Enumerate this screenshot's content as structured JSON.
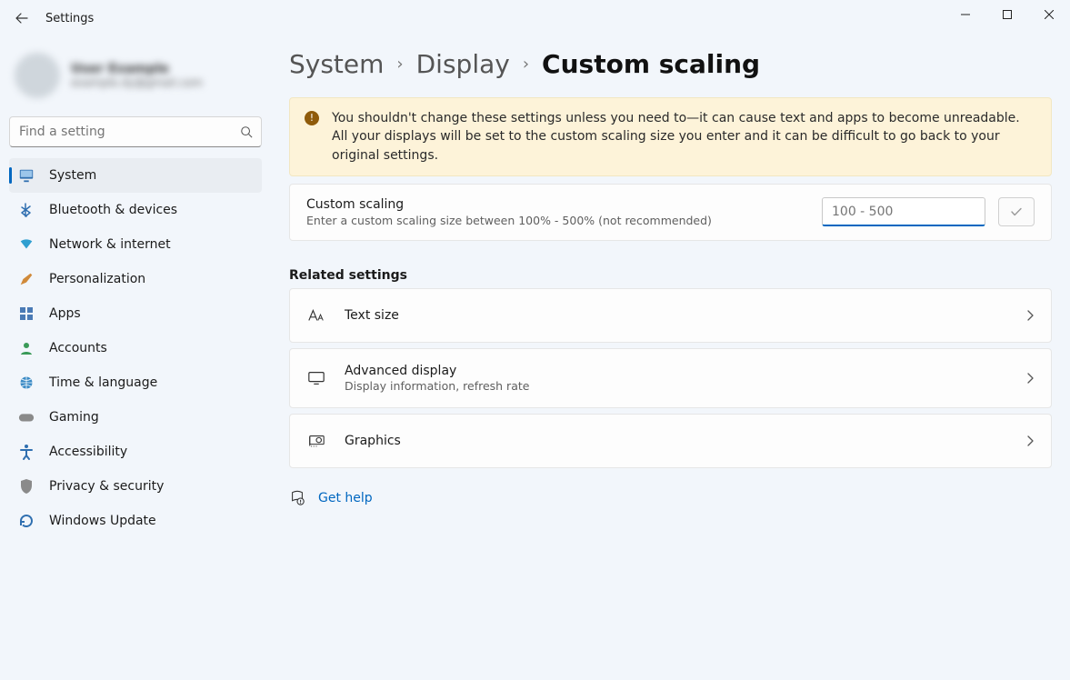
{
  "app_title": "Settings",
  "profile": {
    "name": "User Example",
    "email": "example.dy@gmail.com"
  },
  "search": {
    "placeholder": "Find a setting"
  },
  "sidebar": {
    "items": [
      {
        "label": "System",
        "icon": "monitor",
        "selected": true
      },
      {
        "label": "Bluetooth & devices",
        "icon": "bluetooth",
        "selected": false
      },
      {
        "label": "Network & internet",
        "icon": "wifi",
        "selected": false
      },
      {
        "label": "Personalization",
        "icon": "brush",
        "selected": false
      },
      {
        "label": "Apps",
        "icon": "grid",
        "selected": false
      },
      {
        "label": "Accounts",
        "icon": "person",
        "selected": false
      },
      {
        "label": "Time & language",
        "icon": "globe",
        "selected": false
      },
      {
        "label": "Gaming",
        "icon": "gamepad",
        "selected": false
      },
      {
        "label": "Accessibility",
        "icon": "access",
        "selected": false
      },
      {
        "label": "Privacy & security",
        "icon": "shield",
        "selected": false
      },
      {
        "label": "Windows Update",
        "icon": "update",
        "selected": false
      }
    ]
  },
  "breadcrumb": {
    "parts": [
      "System",
      "Display"
    ],
    "current": "Custom scaling"
  },
  "banner": {
    "text": "You shouldn't change these settings unless you need to—it can cause text and apps to become unreadable. All your displays will be set to the custom scaling size you enter and it can be difficult to go back to your original settings."
  },
  "custom_scaling": {
    "title": "Custom scaling",
    "subtitle": "Enter a custom scaling size between 100% - 500% (not recommended)",
    "placeholder": "100 - 500",
    "value": ""
  },
  "related": {
    "heading": "Related settings",
    "items": [
      {
        "title": "Text size",
        "subtitle": "",
        "icon": "textsize"
      },
      {
        "title": "Advanced display",
        "subtitle": "Display information, refresh rate",
        "icon": "monitor2"
      },
      {
        "title": "Graphics",
        "subtitle": "",
        "icon": "gpu"
      }
    ]
  },
  "help": {
    "label": "Get help"
  }
}
